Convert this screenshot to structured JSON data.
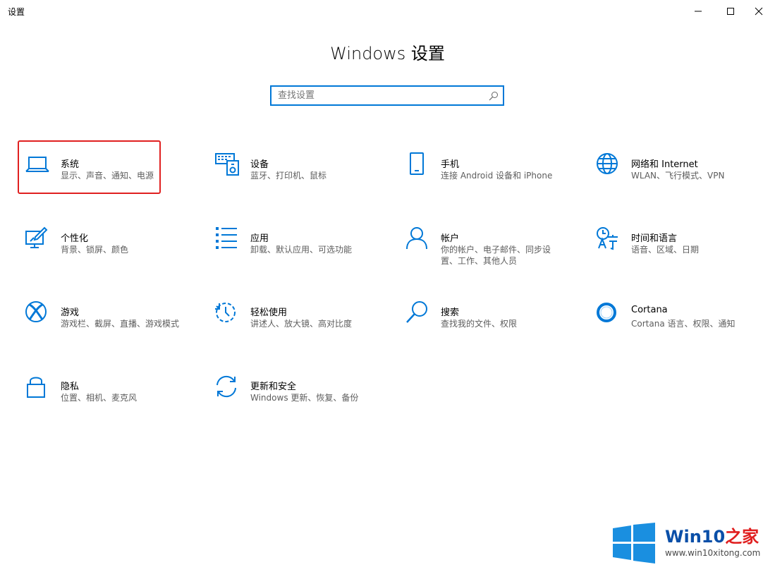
{
  "window": {
    "title": "设置"
  },
  "heading": "Windows 设置",
  "search": {
    "placeholder": "查找设置",
    "value": ""
  },
  "accent_color": "#0078d7",
  "highlight_color": "#e02020",
  "tiles": [
    {
      "icon": "laptop-icon",
      "title": "系统",
      "subtitle": "显示、声音、通知、电源",
      "highlighted": true
    },
    {
      "icon": "keyboard-icon",
      "title": "设备",
      "subtitle": "蓝牙、打印机、鼠标"
    },
    {
      "icon": "phone-icon",
      "title": "手机",
      "subtitle": "连接 Android 设备和 iPhone"
    },
    {
      "icon": "globe-icon",
      "title": "网络和 Internet",
      "subtitle": "WLAN、飞行模式、VPN"
    },
    {
      "icon": "personalization-icon",
      "title": "个性化",
      "subtitle": "背景、锁屏、颜色"
    },
    {
      "icon": "apps-icon",
      "title": "应用",
      "subtitle": "卸载、默认应用、可选功能"
    },
    {
      "icon": "person-icon",
      "title": "帐户",
      "subtitle": "你的帐户、电子邮件、同步设置、工作、其他人员"
    },
    {
      "icon": "time-language-icon",
      "title": "时间和语言",
      "subtitle": "语音、区域、日期"
    },
    {
      "icon": "xbox-icon",
      "title": "游戏",
      "subtitle": "游戏栏、截屏、直播、游戏模式"
    },
    {
      "icon": "ease-of-access-icon",
      "title": "轻松使用",
      "subtitle": "讲述人、放大镜、高对比度"
    },
    {
      "icon": "search-icon",
      "title": "搜索",
      "subtitle": "查找我的文件、权限"
    },
    {
      "icon": "cortana-icon",
      "title": "Cortana",
      "subtitle": "Cortana 语言、权限、通知"
    },
    {
      "icon": "lock-icon",
      "title": "隐私",
      "subtitle": "位置、相机、麦克风"
    },
    {
      "icon": "sync-icon",
      "title": "更新和安全",
      "subtitle": "Windows 更新、恢复、备份"
    }
  ],
  "watermark": {
    "brand": "Win10",
    "brand_suffix": "之家",
    "url": "www.win10xitong.com"
  }
}
